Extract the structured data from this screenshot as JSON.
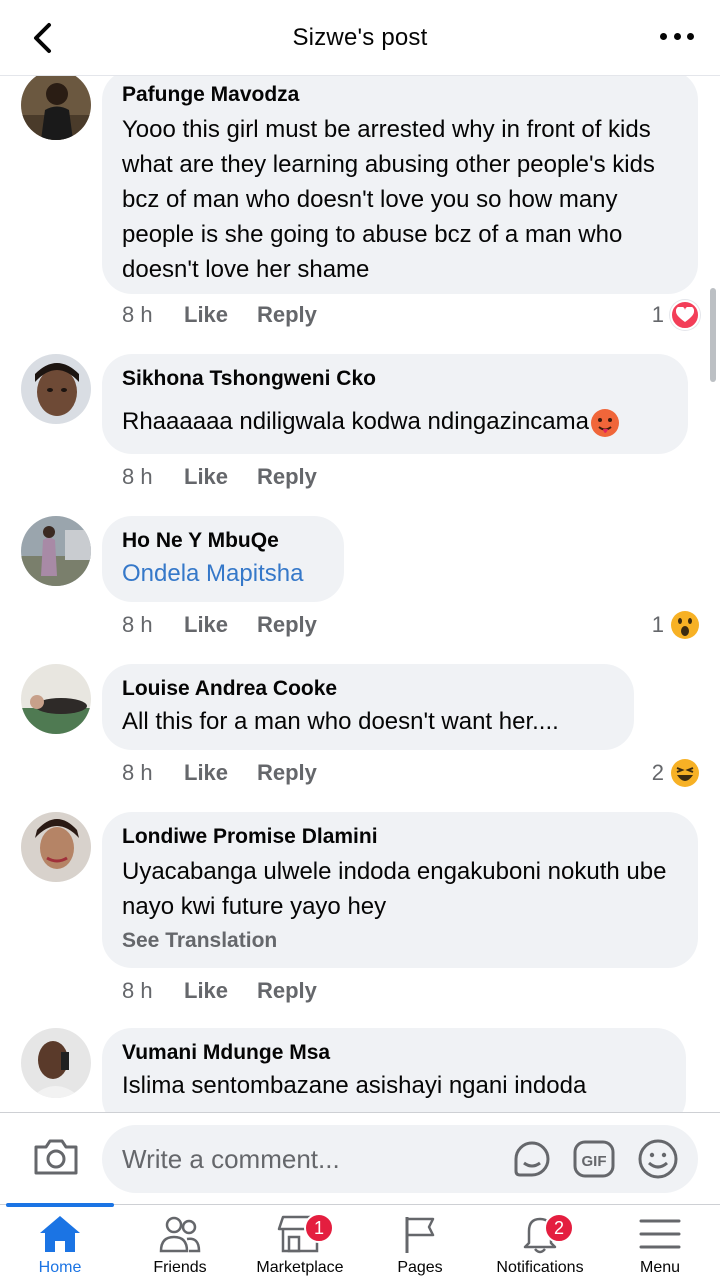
{
  "header": {
    "title": "Sizwe's post"
  },
  "comments": [
    {
      "author": "Pafunge Mavodza",
      "text": "Yooo this girl must be arrested why in front of kids what are they learning abusing other people's kids bcz of man  who doesn't love you so how many people is she going to abuse bcz of a  man who  doesn't love her shame",
      "time": "8 h",
      "like": "Like",
      "reply": "Reply",
      "reaction_count": "1",
      "reaction_icon": "love-reaction-icon"
    },
    {
      "author": "Sikhona Tshongweni Cko",
      "text": "Rhaaaaaa ndiligwala kodwa ndingazincama",
      "time": "8 h",
      "like": "Like",
      "reply": "Reply"
    },
    {
      "author": "Ho Ne Y MbuQe",
      "text": "Ondela Mapitsha",
      "time": "8 h",
      "like": "Like",
      "reply": "Reply",
      "reaction_count": "1",
      "reaction_icon": "wow-reaction-icon"
    },
    {
      "author": "Louise Andrea Cooke",
      "text": "All this for a man who doesn't want her....",
      "time": "8 h",
      "like": "Like",
      "reply": "Reply",
      "reaction_count": "2",
      "reaction_icon": "haha-reaction-icon"
    },
    {
      "author": "Londiwe Promise Dlamini",
      "text": "Uyacabanga ulwele indoda engakuboni nokuth ube nayo kwi future yayo hey",
      "see_translation": "See Translation",
      "time": "8 h",
      "like": "Like",
      "reply": "Reply"
    },
    {
      "author": "Vumani Mdunge Msa",
      "text": "Islima sentombazane asishayi ngani indoda"
    }
  ],
  "composer": {
    "placeholder": "Write a comment..."
  },
  "nav": {
    "tabs": [
      {
        "label": "Home",
        "icon": "home-icon",
        "active": true
      },
      {
        "label": "Friends",
        "icon": "friends-icon"
      },
      {
        "label": "Marketplace",
        "icon": "marketplace-icon",
        "badge": "1"
      },
      {
        "label": "Pages",
        "icon": "pages-flag-icon"
      },
      {
        "label": "Notifications",
        "icon": "bell-icon",
        "badge": "2"
      },
      {
        "label": "Menu",
        "icon": "hamburger-menu-icon"
      }
    ]
  },
  "colors": {
    "accent": "#1b74e4",
    "bubble": "#f0f2f5",
    "link": "#3578c9",
    "badge": "#e41e3f",
    "meta": "#65676b"
  }
}
